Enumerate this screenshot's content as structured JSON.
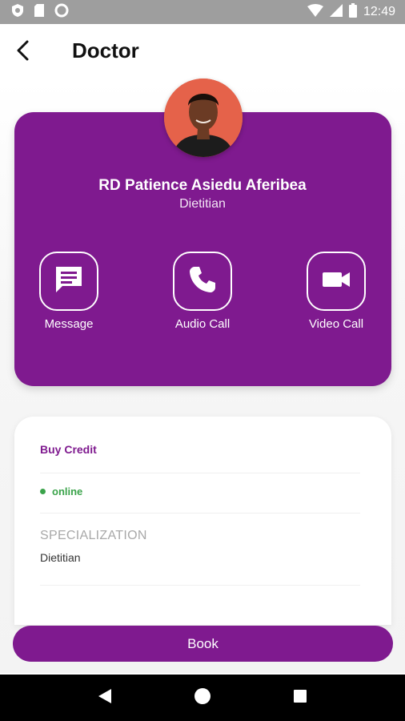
{
  "status_bar": {
    "time": "12:49",
    "icons_left": [
      "shield-icon",
      "sd-card-icon",
      "circle-icon"
    ],
    "icons_right": [
      "wifi-icon",
      "signal-icon",
      "battery-icon"
    ]
  },
  "header": {
    "title": "Doctor",
    "back_icon": "back-arrow-icon"
  },
  "profile": {
    "name": "RD Patience Asiedu Aferibea",
    "role": "Dietitian",
    "actions": [
      {
        "label": "Message",
        "icon": "message-icon"
      },
      {
        "label": "Audio Call",
        "icon": "phone-icon"
      },
      {
        "label": "Video Call",
        "icon": "video-camera-icon"
      }
    ]
  },
  "info": {
    "buy_credit": "Buy Credit",
    "status": "online",
    "specialization_label": "SPECIALIZATION",
    "specialization_value": "Dietitian"
  },
  "book_button": "Book",
  "colors": {
    "brand_purple": "#7f1a8f",
    "online_green": "#3aa34a",
    "status_bar": "#9e9e9e"
  }
}
